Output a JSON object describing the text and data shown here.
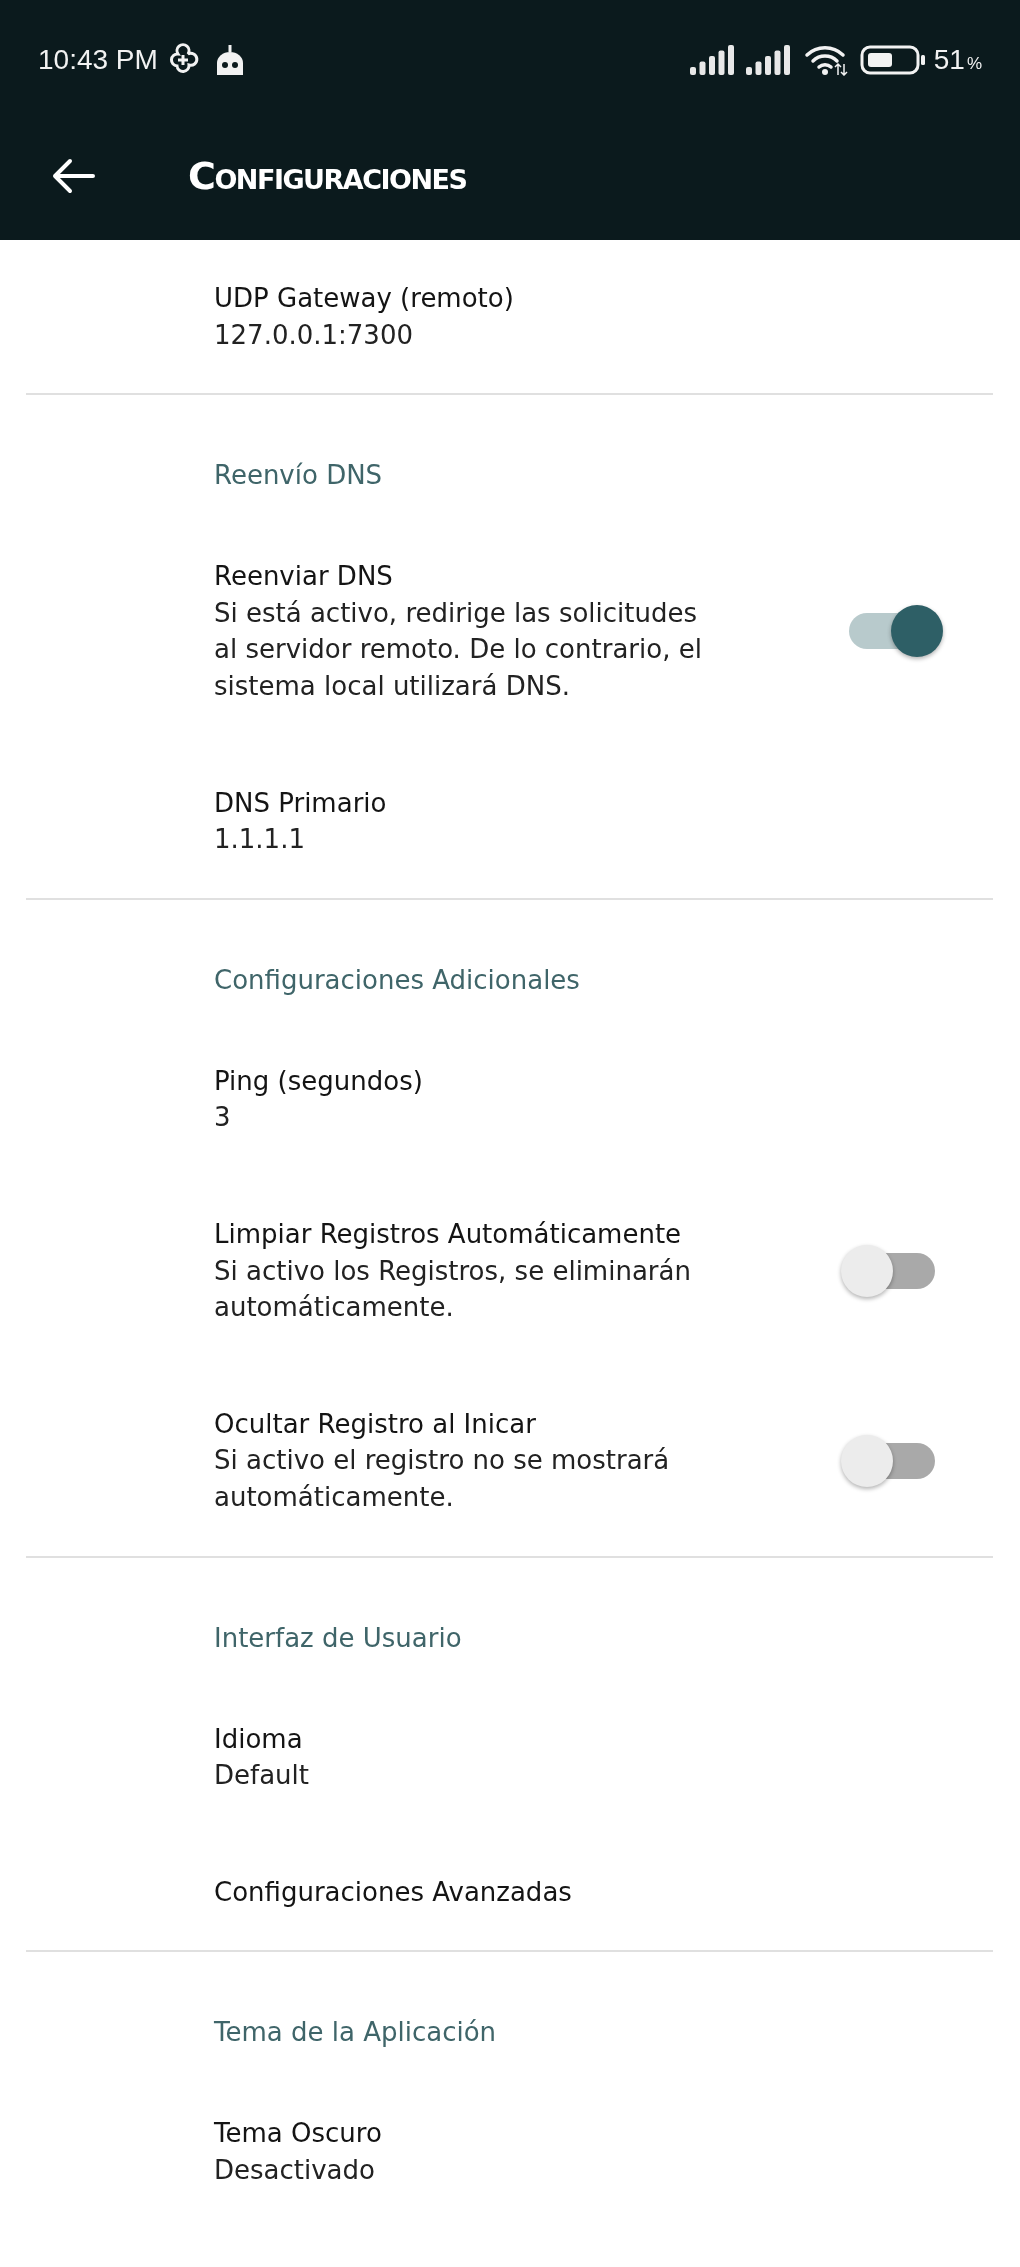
{
  "status_bar": {
    "time": "10:43 PM",
    "battery_value": "51",
    "battery_unit": "%"
  },
  "toolbar": {
    "title": "Configuraciones"
  },
  "sections": [
    {
      "items": [
        {
          "kind": "value",
          "title": "UDP Gateway (remoto)",
          "summary": "127.0.0.1:7300"
        }
      ]
    },
    {
      "header": "Reenvío DNS",
      "items": [
        {
          "kind": "switch",
          "title": "Reenviar DNS",
          "summary": "Si está activo, redirige las solicitudes al servidor remoto. De lo contrario, el sistema local utilizará DNS.",
          "on": true
        },
        {
          "kind": "value",
          "title": "DNS Primario",
          "summary": "1.1.1.1"
        }
      ]
    },
    {
      "header": "Configuraciones Adicionales",
      "items": [
        {
          "kind": "value",
          "title": "Ping (segundos)",
          "summary": "3"
        },
        {
          "kind": "switch",
          "title": "Limpiar Registros Automáticamente",
          "summary": "Si activo los Registros, se eliminarán automáticamente.",
          "on": false
        },
        {
          "kind": "switch",
          "title": "Ocultar Registro al Inicar",
          "summary": "Si activo el registro no se mostrará automáticamente.",
          "on": false
        }
      ]
    },
    {
      "header": "Interfaz de Usuario",
      "items": [
        {
          "kind": "value",
          "title": "Idioma",
          "summary": "Default"
        },
        {
          "kind": "value",
          "title": "Configuraciones Avanzadas"
        }
      ]
    },
    {
      "header": "Tema de la Aplicación",
      "items": [
        {
          "kind": "value",
          "title": "Tema Oscuro",
          "summary": "Desactivado"
        }
      ]
    }
  ]
}
